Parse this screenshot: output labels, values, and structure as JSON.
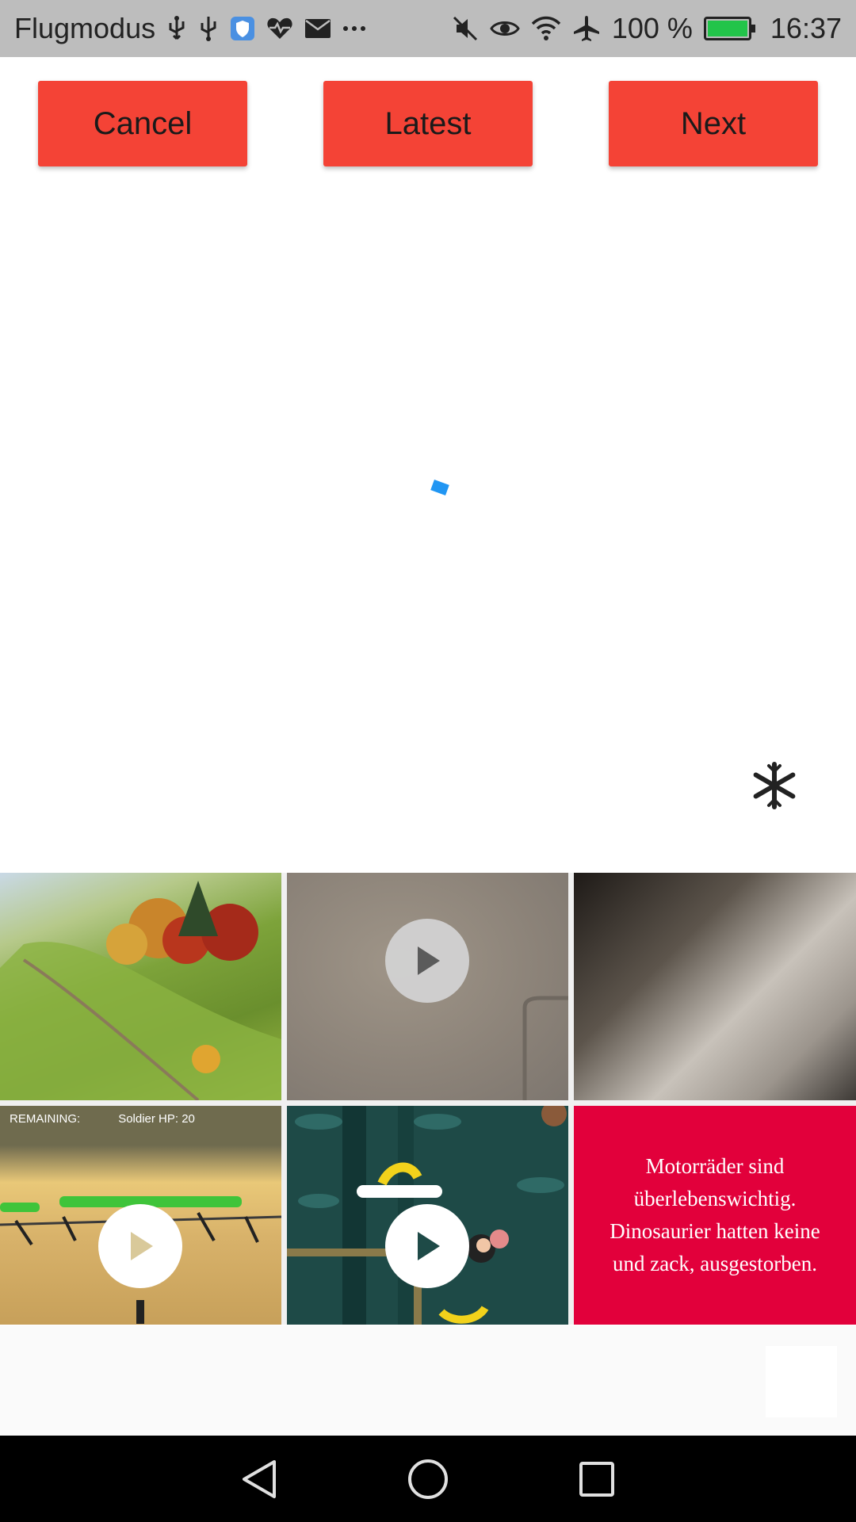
{
  "status_bar": {
    "mode_label": "Flugmodus",
    "battery_label": "100 %",
    "time": "16:37",
    "battery_level": 1.0,
    "icons_left": [
      "usb-icon",
      "usb-icon",
      "shield-app-icon",
      "health-icon",
      "mail-icon",
      "more-icon"
    ],
    "icons_right": [
      "muted-icon",
      "eye-icon",
      "wifi-icon",
      "airplane-icon",
      "battery-charging-icon"
    ]
  },
  "toolbar": {
    "cancel_label": "Cancel",
    "latest_label": "Latest",
    "next_label": "Next"
  },
  "preview": {
    "loading": true,
    "action_icon": "snowflake-icon"
  },
  "grid": {
    "tiles": [
      {
        "kind": "image",
        "subject": "autumn-hills"
      },
      {
        "kind": "video",
        "subject": "grey-surface"
      },
      {
        "kind": "image",
        "subject": "blurred-dark"
      },
      {
        "kind": "video",
        "subject": "game-screenshot",
        "hud_left": "REMAINING:",
        "hud_right": "Soldier HP: 20"
      },
      {
        "kind": "video",
        "subject": "monkey-game"
      },
      {
        "kind": "image",
        "subject": "text-card",
        "caption_lines": [
          "Motorräder sind",
          "überlebenswichtig.",
          "Dinosaurier hatten keine",
          "und zack, ausgestorben."
        ]
      }
    ]
  },
  "colors": {
    "accent": "#f44336",
    "status_bar": "#bdbdbd",
    "spinner": "#2196f3",
    "card_red": "#e2003b"
  },
  "nav": {
    "icons": [
      "back-icon",
      "home-icon",
      "recents-icon"
    ]
  }
}
